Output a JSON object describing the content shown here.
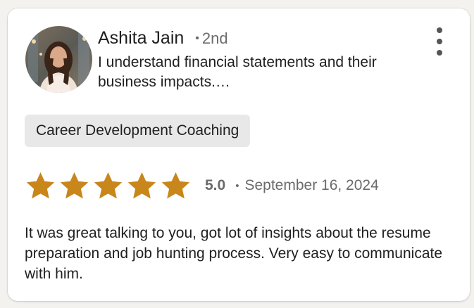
{
  "reviewer": {
    "name": "Ashita Jain",
    "separator": "•",
    "connection": "2nd",
    "headline": "I understand financial statements and their business impacts.…",
    "avatar_icon": "profile-photo"
  },
  "menu": {
    "icon": "vertical-ellipsis-icon"
  },
  "service_tag": "Career Development Coaching",
  "rating": {
    "stars": 5,
    "max_stars": 5,
    "score": "5.0",
    "separator": "•",
    "date": "September 16, 2024",
    "star_color": "#c8861b"
  },
  "review_text": "It was great talking to you, got lot of insights about the resume preparation and job hunting process. Very easy to communicate with him."
}
